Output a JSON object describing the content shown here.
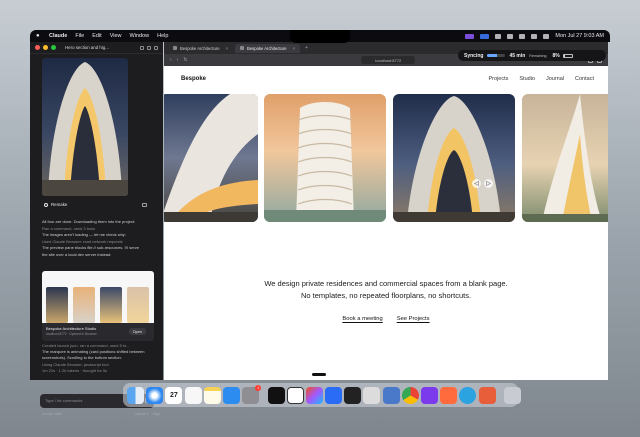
{
  "menubar": {
    "app_name": "Claude",
    "items": [
      "File",
      "Edit",
      "View",
      "Window",
      "Help"
    ],
    "clock": "Mon Jul 27  9:03 AM"
  },
  "claude_panel": {
    "title": "Hero section and hig...",
    "remake_label": "Remake",
    "messages": [
      "All four are done. Downloading them into the project:",
      "Ran a command, used 3 tools",
      "The images aren't loading — let me check why:",
      "Used Claude Browser: read network requests",
      "The preview pane blocks file:// sub-resources. I'll serve",
      "the site over a local dev server instead:"
    ],
    "card": {
      "title": "Bespoke Architecture Studio",
      "subtitle": "localhost:8772 · Opened in Browser",
      "open_label": "Open"
    },
    "messages2": [
      "Created launch.json, ran a command, used 5 to...",
      "The marquee is animating (card positions shifted between",
      "screenshots). Scrolling to the bottom section:",
      "Using Claude Browser: javascript tool",
      "1m 22s · 1.2k tokens · thought for 5s"
    ],
    "composer_placeholder": "Type / for commands",
    "footer": {
      "left": "Accept edits",
      "right": "Claude 4",
      "extra": "High"
    }
  },
  "browser": {
    "tabs": [
      {
        "label": "Bespoke Architecture"
      },
      {
        "label": "Bespoke Architecture"
      }
    ],
    "url": "localhost:8772"
  },
  "status_pill": {
    "label": "Syncing",
    "progress": 0.55,
    "timer": "45 min",
    "timer_sub": "Remaining",
    "battery": "8%",
    "battery_level": 0.08
  },
  "site": {
    "brand": "Bespoke",
    "nav": [
      "Projects",
      "Studio",
      "Journal",
      "Contact"
    ],
    "tagline_1": "We design private residences and commercial spaces from a blank page.",
    "tagline_2": "No templates, no repeated floorplans, no shortcuts.",
    "cta_primary": "Book a meeting",
    "cta_secondary": "See Projects",
    "carousel_prev": "◁",
    "carousel_next": "▷"
  },
  "dock": {
    "calendar_day": "27",
    "mail_badge": "1",
    "apps": [
      "finder-icon",
      "safari-icon",
      "calendar-icon",
      "reminders-icon",
      "notes-icon",
      "app-store-icon",
      "system-settings-icon",
      "capcut-icon",
      "notion-icon",
      "figma-icon",
      "arc-icon",
      "capcut-alt-icon",
      "cube-icon",
      "preview-icon",
      "chrome-icon",
      "obsidian-icon",
      "spark-icon",
      "telegram-icon",
      "claude-icon",
      "trash-icon"
    ]
  }
}
